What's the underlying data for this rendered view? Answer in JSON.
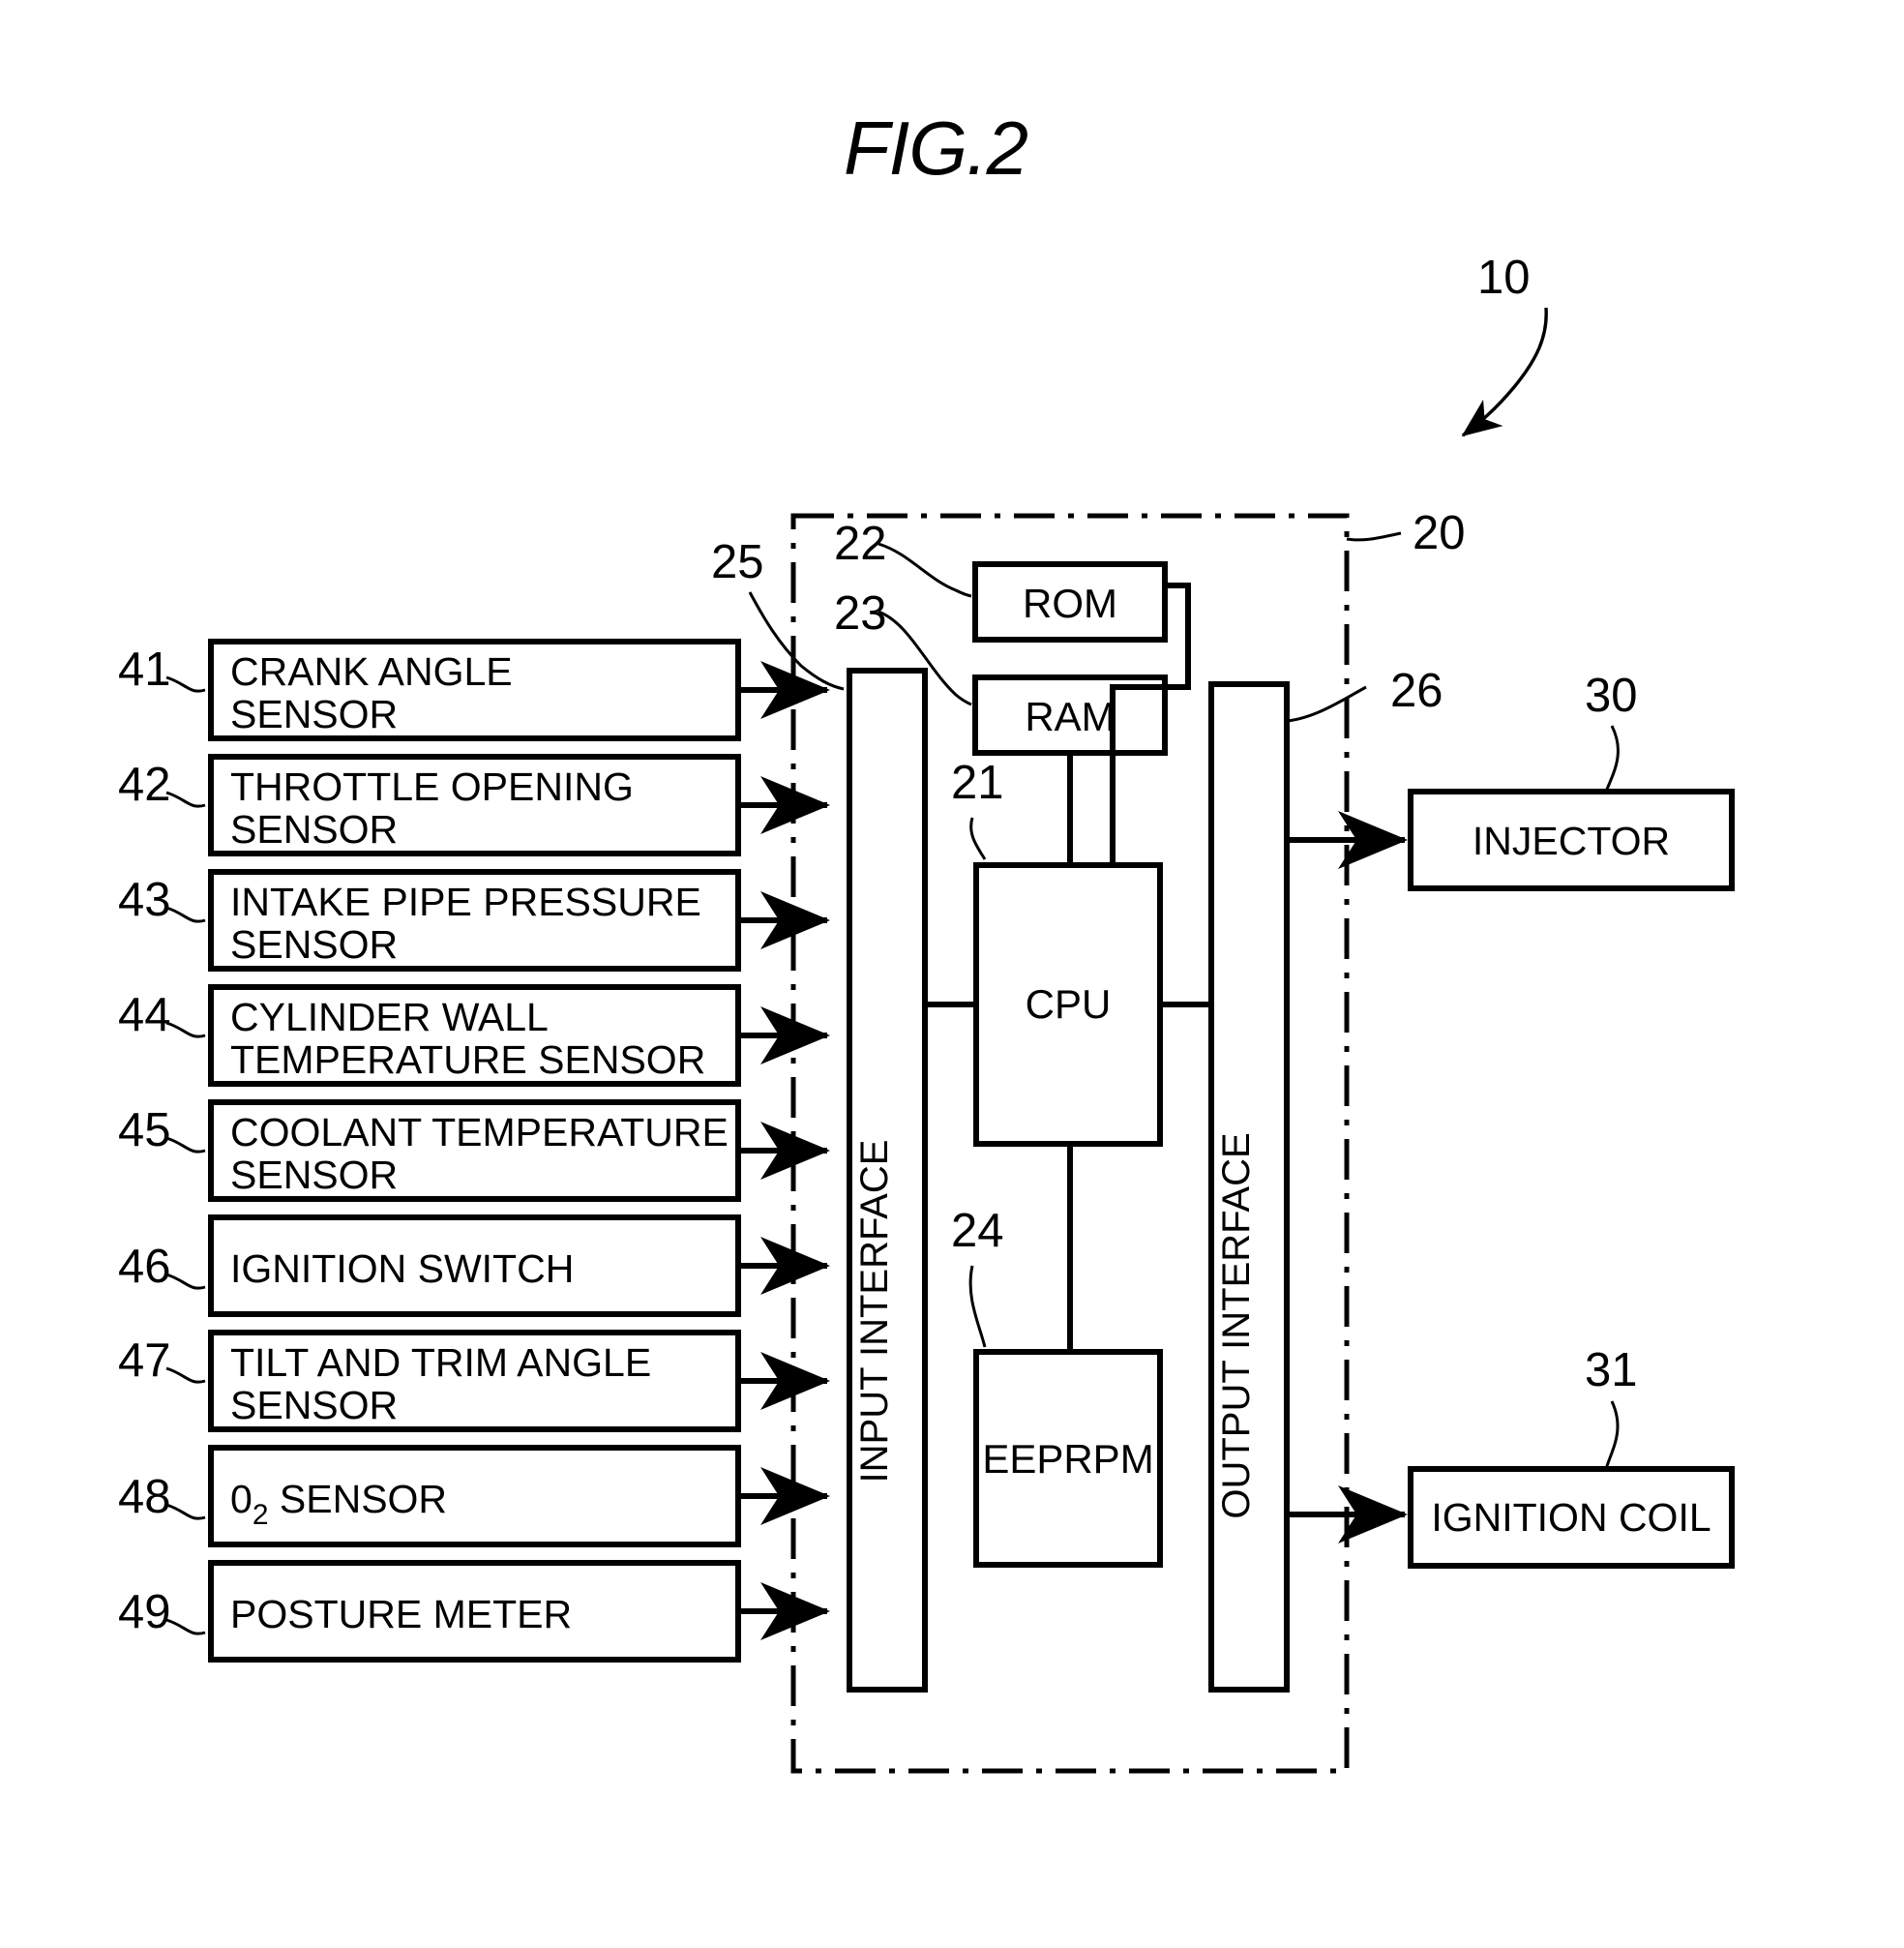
{
  "figure": {
    "title": "FIG.2",
    "system_ref": "10"
  },
  "ecu": {
    "ref": "20",
    "input_interface": {
      "label": "INPUT INTERFACE",
      "ref": "25"
    },
    "output_interface": {
      "label": "OUTPUT INTERFACE",
      "ref": "26"
    },
    "components": [
      {
        "label": "ROM",
        "ref": "22"
      },
      {
        "label": "RAM",
        "ref": "23"
      },
      {
        "label": "CPU",
        "ref": "21"
      },
      {
        "label": "EEPRPM",
        "ref": "24"
      }
    ]
  },
  "inputs": [
    {
      "ref": "41",
      "line1": "CRANK ANGLE",
      "line2": "SENSOR"
    },
    {
      "ref": "42",
      "line1": "THROTTLE OPENING",
      "line2": "SENSOR"
    },
    {
      "ref": "43",
      "line1": "INTAKE PIPE PRESSURE",
      "line2": "SENSOR"
    },
    {
      "ref": "44",
      "line1": "CYLINDER WALL",
      "line2": "TEMPERATURE SENSOR"
    },
    {
      "ref": "45",
      "line1": "COOLANT TEMPERATURE",
      "line2": "SENSOR"
    },
    {
      "ref": "46",
      "line1": "IGNITION SWITCH",
      "line2": ""
    },
    {
      "ref": "47",
      "line1": "TILT AND TRIM ANGLE",
      "line2": "SENSOR"
    },
    {
      "ref": "48",
      "line1": "0",
      "sub": "2",
      "line1b": " SENSOR",
      "line2": ""
    },
    {
      "ref": "49",
      "line1": "POSTURE METER",
      "line2": ""
    }
  ],
  "outputs": [
    {
      "ref": "30",
      "label": "INJECTOR"
    },
    {
      "ref": "31",
      "label": "IGNITION COIL"
    }
  ],
  "colors": {
    "stroke": "#000000",
    "background": "#ffffff"
  }
}
